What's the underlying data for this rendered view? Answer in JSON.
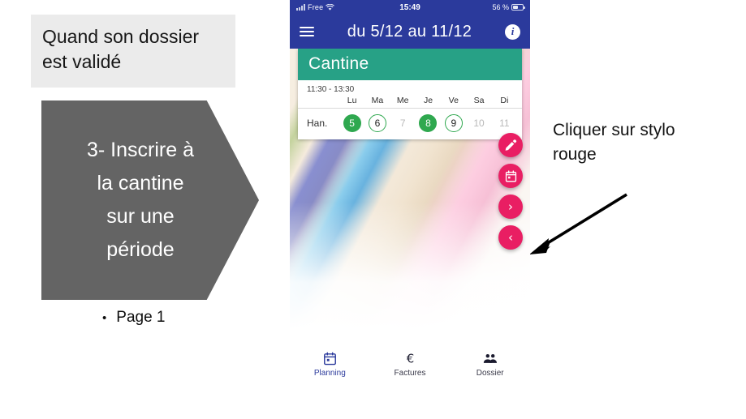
{
  "slide": {
    "note": "Quand son\ndossier est validé",
    "step_shape_text": "3- Inscrire à\nla cantine\nsur une\npériode",
    "bullet_dot": "•",
    "bullet_text": "Page 1",
    "callout": "Cliquer sur stylo\nrouge",
    "colors": {
      "note_bg": "#EBEBEB",
      "shape_bg": "#646464",
      "arrow": "#000000"
    }
  },
  "phone": {
    "statusbar": {
      "carrier": "Free",
      "time": "15:49",
      "battery": "56 %",
      "signal_icon": "signal-bars-icon",
      "wifi_icon": "wifi-icon",
      "battery_icon": "battery-icon"
    },
    "appbar": {
      "menu_icon": "hamburger-menu-icon",
      "title": "du 5/12 au 11/12",
      "info_icon": "info-icon",
      "info_label": "i",
      "bg_color": "#2B3A9C"
    },
    "card": {
      "title": "Cantine",
      "header_color": "#27A186",
      "time_range": "11:30 - 13:30",
      "row_label": "Han.",
      "day_names": [
        "Lu",
        "Ma",
        "Me",
        "Je",
        "Ve",
        "Sa",
        "Di"
      ],
      "days": [
        {
          "num": "5",
          "state": "filled"
        },
        {
          "num": "6",
          "state": "outline"
        },
        {
          "num": "7",
          "state": "plain"
        },
        {
          "num": "8",
          "state": "filled"
        },
        {
          "num": "9",
          "state": "outline"
        },
        {
          "num": "10",
          "state": "plain"
        },
        {
          "num": "11",
          "state": "plain"
        }
      ],
      "state_colors": {
        "filled": "#2FA84F",
        "outline": "#2FA84F",
        "plain": "#B9B9B9"
      }
    },
    "fabs": [
      {
        "icon": "pencil-icon",
        "label": ""
      },
      {
        "icon": "calendar-icon",
        "label": ""
      },
      {
        "icon": "chevron-right-icon",
        "label": "›"
      },
      {
        "icon": "chevron-left-icon",
        "label": "‹"
      }
    ],
    "fab_color": "#E91E63",
    "bottomnav": [
      {
        "label": "Planning",
        "icon": "calendar-icon",
        "active": true
      },
      {
        "label": "Factures",
        "icon": "euro-icon",
        "active": false
      },
      {
        "label": "Dossier",
        "icon": "people-icon",
        "active": false
      }
    ]
  }
}
